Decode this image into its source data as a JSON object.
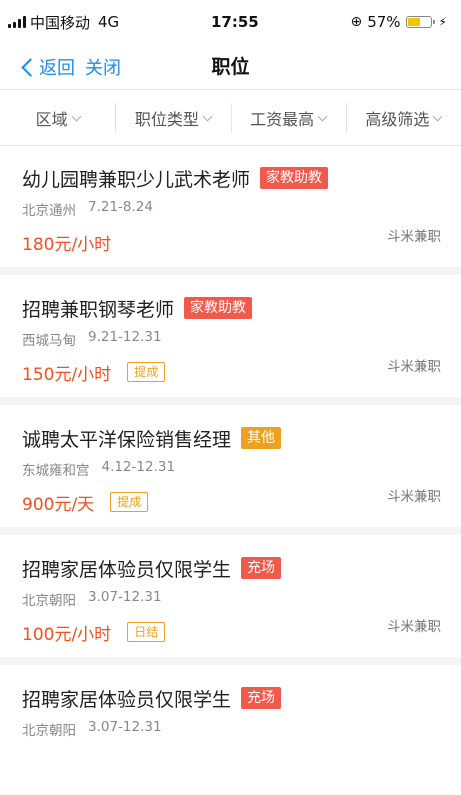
{
  "status_bar": {
    "carrier": "中国移动",
    "network": "4G",
    "time": "17:55",
    "battery_percent": "57%",
    "battery_level": 0.57
  },
  "nav": {
    "back_label": "返回",
    "close_label": "关闭",
    "title": "职位"
  },
  "filters": [
    {
      "label": "区域"
    },
    {
      "label": "职位类型"
    },
    {
      "label": "工资最高"
    },
    {
      "label": "高级筛选"
    }
  ],
  "colors": {
    "accent_blue": "#1d8cf0",
    "pay_red": "#f2501f",
    "tag_red": "#f05a4a",
    "tag_orange": "#f0a020"
  },
  "jobs": [
    {
      "title": "幼儿园聘兼职少儿武术老师",
      "category": "家教助教",
      "category_color": "#f05a4a",
      "location": "北京通州",
      "dates": "7.21-8.24",
      "pay": "180元/小时",
      "extra_tag": "",
      "source": "斗米兼职"
    },
    {
      "title": "招聘兼职钢琴老师",
      "category": "家教助教",
      "category_color": "#f05a4a",
      "location": "西城马甸",
      "dates": "9.21-12.31",
      "pay": "150元/小时",
      "extra_tag": "提成",
      "source": "斗米兼职"
    },
    {
      "title": "诚聘太平洋保险销售经理",
      "category": "其他",
      "category_color": "#f0a020",
      "location": "东城雍和宫",
      "dates": "4.12-12.31",
      "pay": "900元/天",
      "extra_tag": "提成",
      "source": "斗米兼职"
    },
    {
      "title": "招聘家居体验员仅限学生",
      "category": "充场",
      "category_color": "#f05a4a",
      "location": "北京朝阳",
      "dates": "3.07-12.31",
      "pay": "100元/小时",
      "extra_tag": "日结",
      "source": "斗米兼职"
    },
    {
      "title": "招聘家居体验员仅限学生",
      "category": "充场",
      "category_color": "#f05a4a",
      "location": "北京朝阳",
      "dates": "3.07-12.31"
    }
  ]
}
